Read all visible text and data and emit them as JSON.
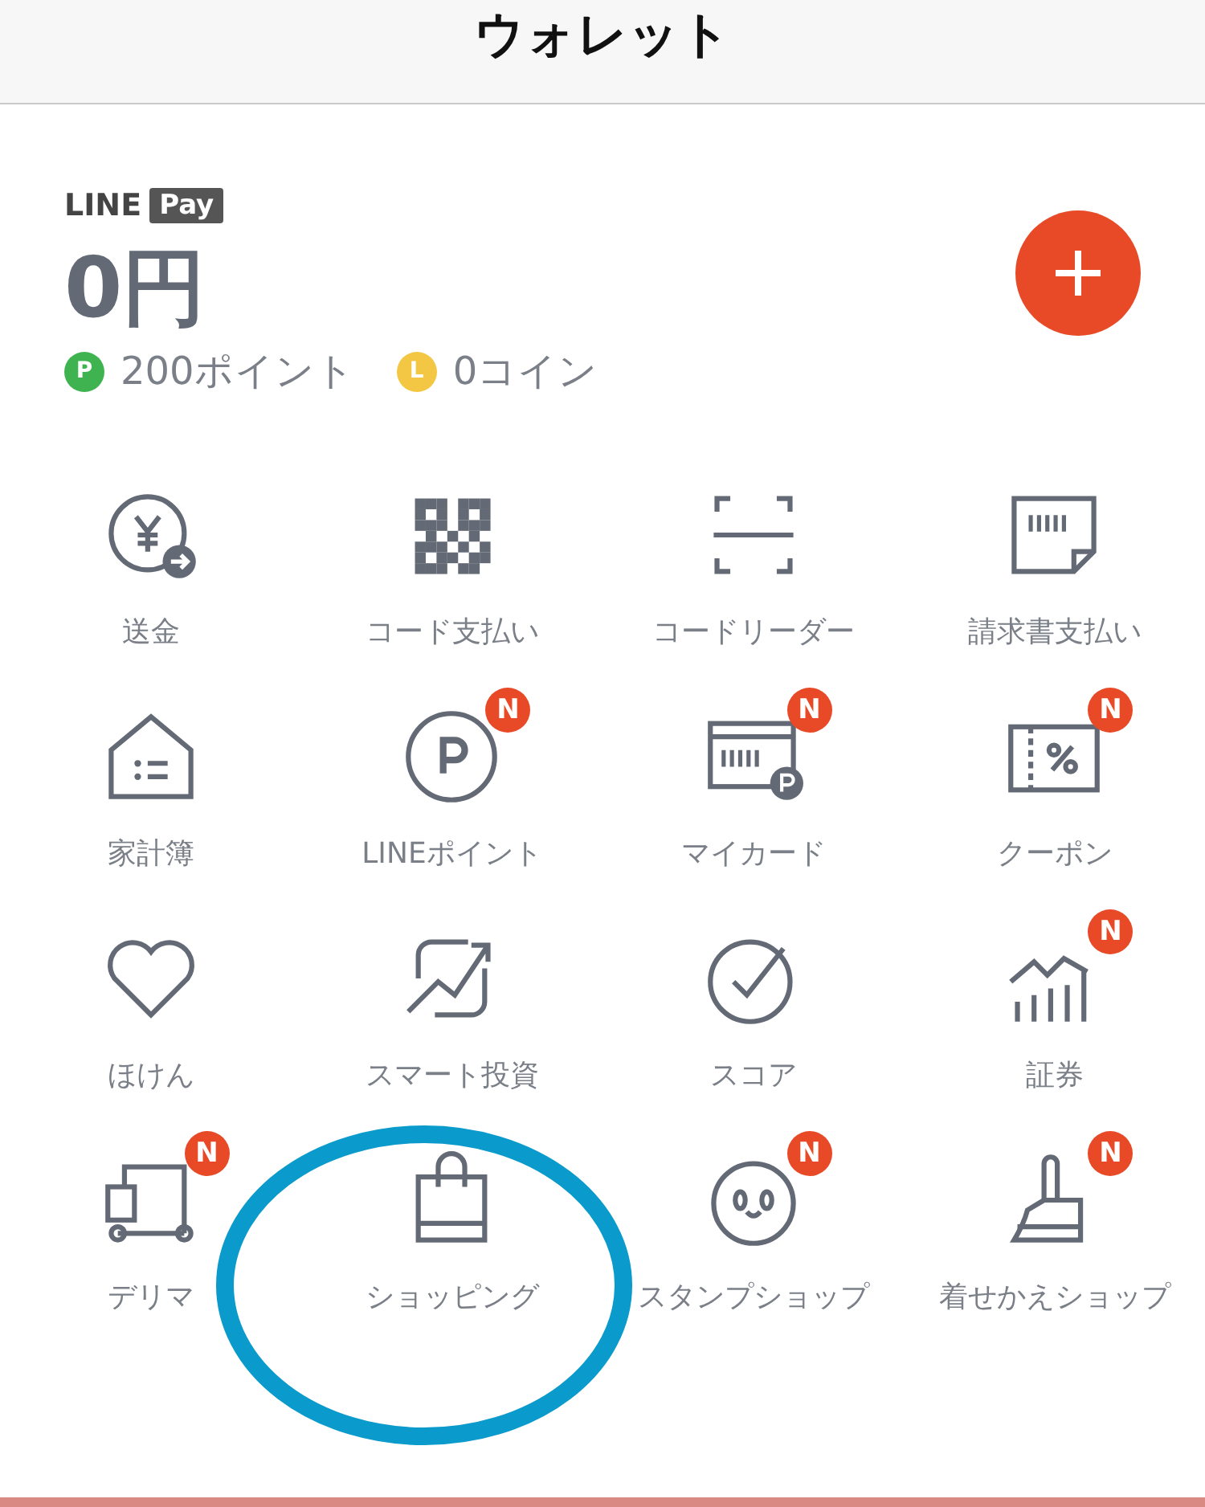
{
  "header": {
    "title": "ウォレット"
  },
  "pay": {
    "logo_line": "LINE",
    "logo_pay": "Pay",
    "balance": "0円",
    "balances": [
      {
        "badge": "P",
        "text": "200ポイント",
        "color": "#3fb34f"
      },
      {
        "badge": "L",
        "text": "0コイン",
        "color": "#f3c643"
      }
    ]
  },
  "menu": [
    {
      "label": "送金"
    },
    {
      "label": "コード支払い"
    },
    {
      "label": "コードリーダー"
    },
    {
      "label": "請求書支払い"
    },
    {
      "label": "家計簿"
    },
    {
      "label": "LINEポイント",
      "badge": "N"
    },
    {
      "label": "マイカード",
      "badge": "N"
    },
    {
      "label": "クーポン",
      "badge": "N"
    },
    {
      "label": "ほけん"
    },
    {
      "label": "スマート投資"
    },
    {
      "label": "スコア"
    },
    {
      "label": "証券",
      "badge": "N"
    },
    {
      "label": "デリマ",
      "badge": "N"
    },
    {
      "label": "ショッピング"
    },
    {
      "label": "スタンプショップ",
      "badge": "N"
    },
    {
      "label": "着せかえショップ",
      "badge": "N"
    }
  ],
  "annotation": {
    "kind": "ellipse"
  }
}
